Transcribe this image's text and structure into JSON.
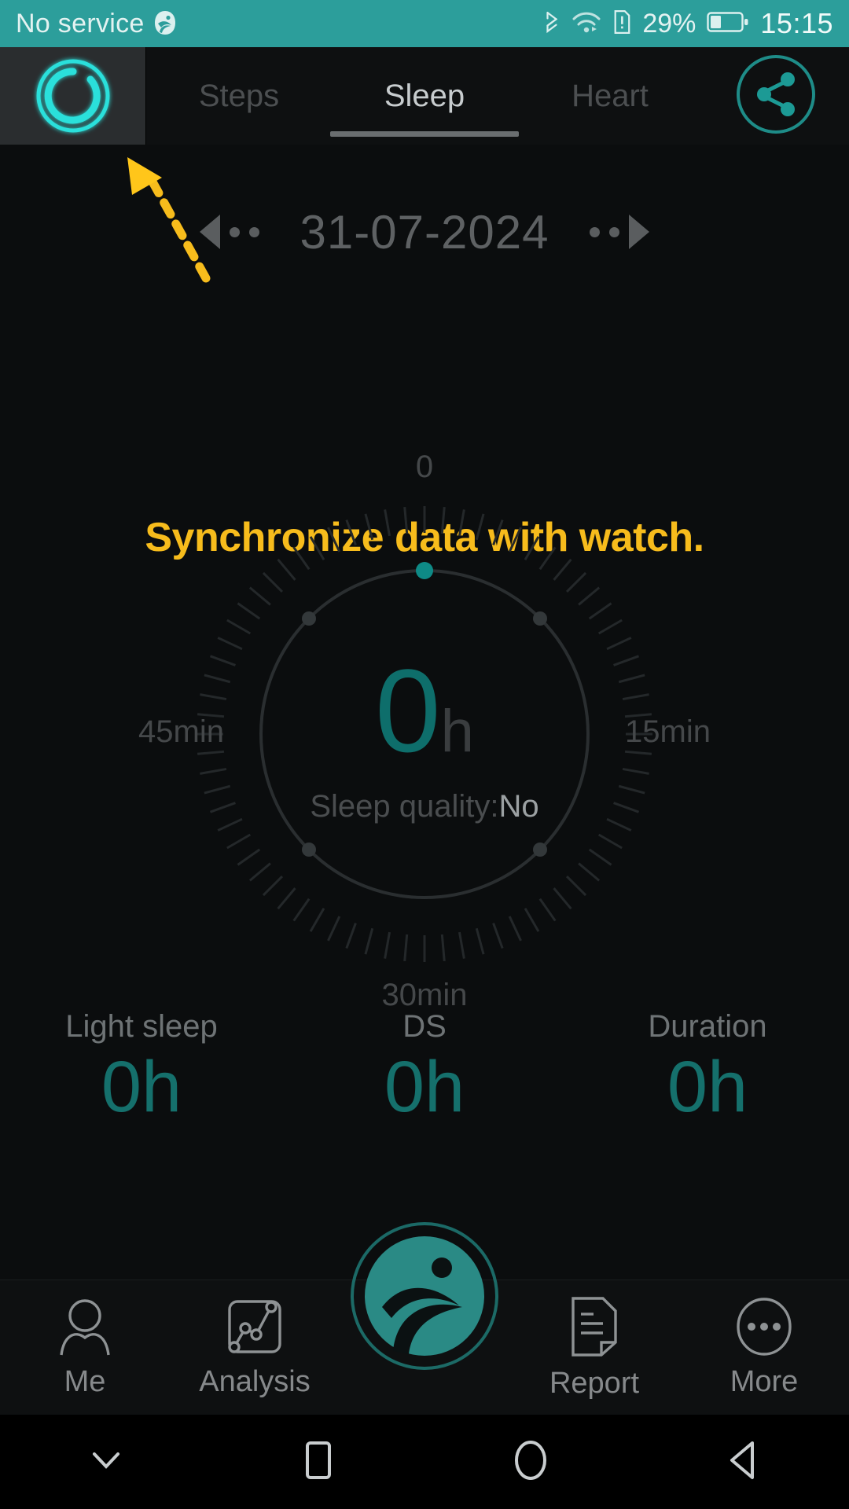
{
  "statusbar": {
    "carrier": "No service",
    "app_icon": "app-logo-icon",
    "bluetooth_icon": "bluetooth-icon",
    "wifi_icon": "wifi-icon",
    "sim_alert_icon": "sim-alert-icon",
    "battery_percent": "29%",
    "battery_icon": "battery-icon",
    "clock": "15:15",
    "background_color": "#2C9E9B"
  },
  "tabbar": {
    "sync_button": {
      "name": "sync-icon",
      "label": "",
      "pressed": true
    },
    "tabs": [
      {
        "label": "Steps",
        "active": false
      },
      {
        "label": "Sleep",
        "active": true
      },
      {
        "label": "Heart",
        "active": false
      }
    ],
    "share_button": "share-icon",
    "accent_color": "#2BE0DB"
  },
  "datebar": {
    "prev_icon": "chevron-left-icon",
    "next_icon": "chevron-right-icon",
    "date": "31-07-2024"
  },
  "annotation": {
    "text": "Synchronize data with watch.",
    "color": "#F7BC1C",
    "arrow_icon": "dashed-arrow-icon"
  },
  "gauge": {
    "top_label": "0",
    "left_label": "45min",
    "right_label": "15min",
    "bottom_label": "30min",
    "center_value": "0",
    "center_unit": "h",
    "quality_prefix": "Sleep quality:",
    "quality_value": "No",
    "marker_color": "#0E8A86",
    "value_color": "#0E6E6B"
  },
  "stats": [
    {
      "label": "Light sleep",
      "value": "0h"
    },
    {
      "label": "DS",
      "value": "0h"
    },
    {
      "label": "Duration",
      "value": "0h"
    }
  ],
  "bottomnav": {
    "items": [
      {
        "label": "Me",
        "icon": "person-icon"
      },
      {
        "label": "Analysis",
        "icon": "chart-icon"
      },
      {
        "label": "Report",
        "icon": "document-icon"
      },
      {
        "label": "More",
        "icon": "ellipsis-circle-icon"
      }
    ],
    "center_logo": "app-logo-icon",
    "logo_color": "#2A8A85"
  },
  "androidnav": {
    "buttons": [
      {
        "icon": "hide-keyboard-icon"
      },
      {
        "icon": "recents-square-icon"
      },
      {
        "icon": "home-circle-icon"
      },
      {
        "icon": "back-triangle-icon"
      }
    ]
  },
  "chart_data": {
    "type": "line",
    "title": "Sleep",
    "subtitle": "31-07-2024",
    "gauge_scale_labels": [
      "0",
      "15min",
      "30min",
      "45min"
    ],
    "total_sleep_hours": 0,
    "sleep_quality": "No",
    "series": [
      {
        "name": "Light sleep",
        "value_hours": 0,
        "value_label": "0h"
      },
      {
        "name": "DS",
        "value_hours": 0,
        "value_label": "0h"
      },
      {
        "name": "Duration",
        "value_hours": 0,
        "value_label": "0h"
      }
    ],
    "xlabel": "",
    "ylabel": "",
    "grid": false,
    "legend": "none"
  }
}
